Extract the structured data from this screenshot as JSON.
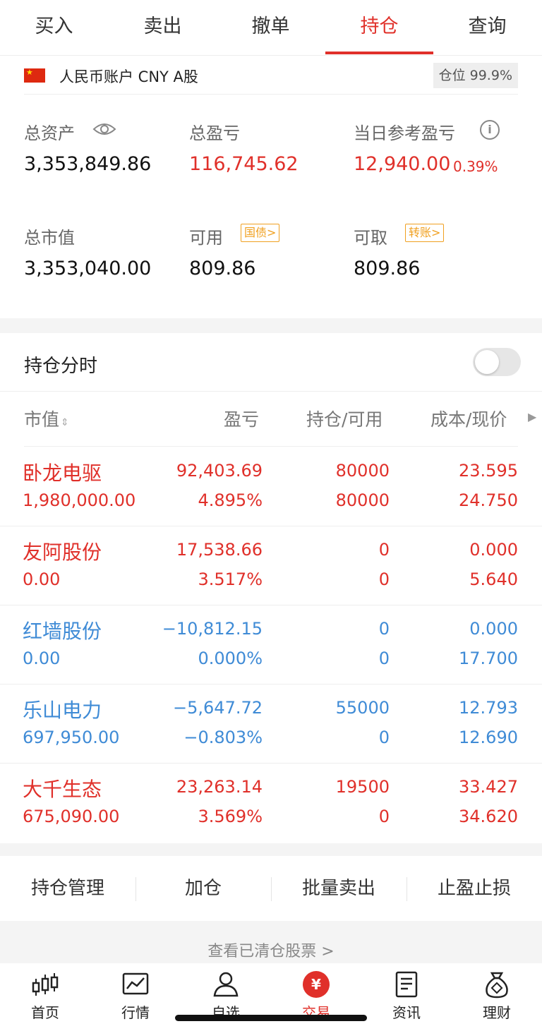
{
  "tabs": [
    {
      "label": "买入"
    },
    {
      "label": "卖出"
    },
    {
      "label": "撤单"
    },
    {
      "label": "持仓",
      "active": true
    },
    {
      "label": "查询"
    }
  ],
  "account": {
    "name": "人民币账户 CNY A股",
    "position_ratio": "仓位 99.9%",
    "total_assets_label": "总资产",
    "total_assets": "3,353,849.86",
    "total_pnl_label": "总盈亏",
    "total_pnl": "116,745.62",
    "daily_pnl_label": "当日参考盈亏",
    "daily_pnl": "12,940.00",
    "daily_pnl_pct": "0.39%",
    "market_value_label": "总市值",
    "market_value": "3,353,040.00",
    "available_label": "可用",
    "available": "809.86",
    "treasury_tag": "国债>",
    "withdrawable_label": "可取",
    "withdrawable": "809.86",
    "transfer_tag": "转账>"
  },
  "timeshare": {
    "label": "持仓分时",
    "enabled": false
  },
  "holdings": {
    "headers": {
      "market_value": "市值",
      "pnl": "盈亏",
      "position": "持仓/可用",
      "cost": "成本/现价"
    },
    "rows": [
      {
        "name": "卧龙电驱",
        "market_value": "1,980,000.00",
        "pnl": "92,403.69",
        "pnl_pct": "4.895%",
        "position": "80000",
        "available": "80000",
        "cost": "23.595",
        "price": "24.750",
        "color": "#e0302a"
      },
      {
        "name": "友阿股份",
        "market_value": "0.00",
        "pnl": "17,538.66",
        "pnl_pct": "3.517%",
        "position": "0",
        "available": "0",
        "cost": "0.000",
        "price": "5.640",
        "color": "#e0302a"
      },
      {
        "name": "红墙股份",
        "market_value": "0.00",
        "pnl": "−10,812.15",
        "pnl_pct": "0.000%",
        "position": "0",
        "available": "0",
        "cost": "0.000",
        "price": "17.700",
        "color": "#3f8bd6"
      },
      {
        "name": "乐山电力",
        "market_value": "697,950.00",
        "pnl": "−5,647.72",
        "pnl_pct": "−0.803%",
        "position": "55000",
        "available": "0",
        "cost": "12.793",
        "price": "12.690",
        "color": "#3f8bd6"
      },
      {
        "name": "大千生态",
        "market_value": "675,090.00",
        "pnl": "23,263.14",
        "pnl_pct": "3.569%",
        "position": "19500",
        "available": "0",
        "cost": "33.427",
        "price": "34.620",
        "color": "#e0302a"
      }
    ]
  },
  "actions": [
    {
      "label": "持仓管理"
    },
    {
      "label": "加仓"
    },
    {
      "label": "批量卖出"
    },
    {
      "label": "止盈止损"
    }
  ],
  "cleared_link": "查看已清仓股票 >",
  "bottom_nav": [
    {
      "label": "首页",
      "icon": "candlestick-icon"
    },
    {
      "label": "行情",
      "icon": "chart-icon"
    },
    {
      "label": "自选",
      "icon": "user-icon"
    },
    {
      "label": "交易",
      "icon": "yuan-icon",
      "active": true
    },
    {
      "label": "资讯",
      "icon": "news-icon"
    },
    {
      "label": "理财",
      "icon": "money-bag-icon"
    }
  ]
}
